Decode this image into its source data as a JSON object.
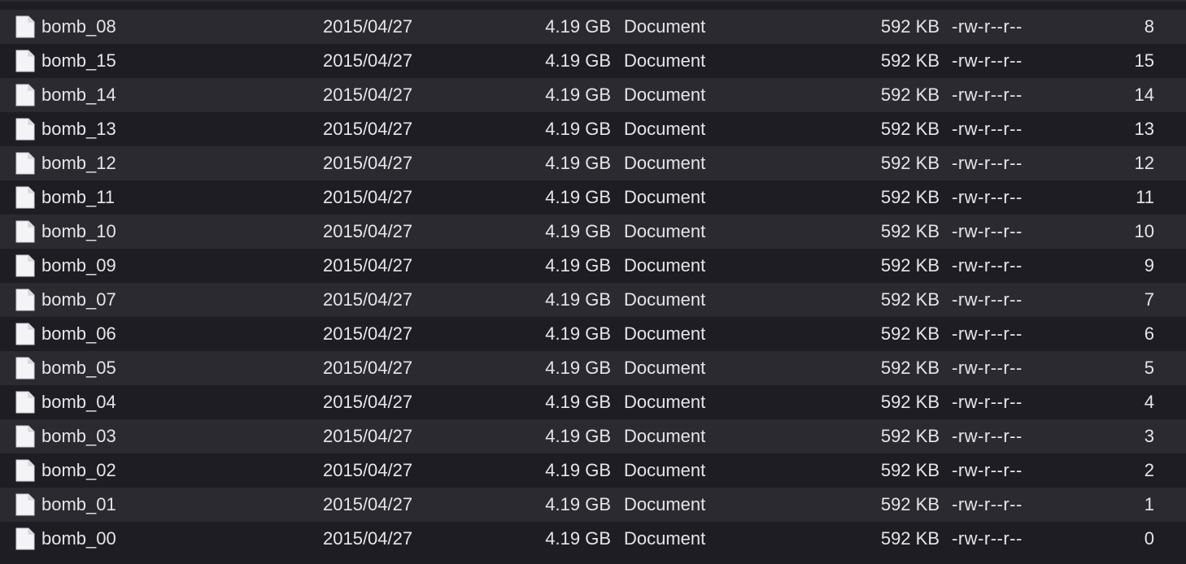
{
  "files": [
    {
      "name": "bomb_08",
      "date": "2015/04/27",
      "size": "4.19 GB",
      "kind": "Document",
      "size_on_disk": "592 KB",
      "permissions": "-rw-r--r--",
      "number": "8",
      "icon": "document-icon"
    },
    {
      "name": "bomb_15",
      "date": "2015/04/27",
      "size": "4.19 GB",
      "kind": "Document",
      "size_on_disk": "592 KB",
      "permissions": "-rw-r--r--",
      "number": "15",
      "icon": "document-icon"
    },
    {
      "name": "bomb_14",
      "date": "2015/04/27",
      "size": "4.19 GB",
      "kind": "Document",
      "size_on_disk": "592 KB",
      "permissions": "-rw-r--r--",
      "number": "14",
      "icon": "document-icon"
    },
    {
      "name": "bomb_13",
      "date": "2015/04/27",
      "size": "4.19 GB",
      "kind": "Document",
      "size_on_disk": "592 KB",
      "permissions": "-rw-r--r--",
      "number": "13",
      "icon": "document-icon"
    },
    {
      "name": "bomb_12",
      "date": "2015/04/27",
      "size": "4.19 GB",
      "kind": "Document",
      "size_on_disk": "592 KB",
      "permissions": "-rw-r--r--",
      "number": "12",
      "icon": "document-icon"
    },
    {
      "name": "bomb_11",
      "date": "2015/04/27",
      "size": "4.19 GB",
      "kind": "Document",
      "size_on_disk": "592 KB",
      "permissions": "-rw-r--r--",
      "number": "11",
      "icon": "document-icon"
    },
    {
      "name": "bomb_10",
      "date": "2015/04/27",
      "size": "4.19 GB",
      "kind": "Document",
      "size_on_disk": "592 KB",
      "permissions": "-rw-r--r--",
      "number": "10",
      "icon": "document-icon"
    },
    {
      "name": "bomb_09",
      "date": "2015/04/27",
      "size": "4.19 GB",
      "kind": "Document",
      "size_on_disk": "592 KB",
      "permissions": "-rw-r--r--",
      "number": "9",
      "icon": "document-icon"
    },
    {
      "name": "bomb_07",
      "date": "2015/04/27",
      "size": "4.19 GB",
      "kind": "Document",
      "size_on_disk": "592 KB",
      "permissions": "-rw-r--r--",
      "number": "7",
      "icon": "document-icon"
    },
    {
      "name": "bomb_06",
      "date": "2015/04/27",
      "size": "4.19 GB",
      "kind": "Document",
      "size_on_disk": "592 KB",
      "permissions": "-rw-r--r--",
      "number": "6",
      "icon": "document-icon"
    },
    {
      "name": "bomb_05",
      "date": "2015/04/27",
      "size": "4.19 GB",
      "kind": "Document",
      "size_on_disk": "592 KB",
      "permissions": "-rw-r--r--",
      "number": "5",
      "icon": "document-icon"
    },
    {
      "name": "bomb_04",
      "date": "2015/04/27",
      "size": "4.19 GB",
      "kind": "Document",
      "size_on_disk": "592 KB",
      "permissions": "-rw-r--r--",
      "number": "4",
      "icon": "document-icon"
    },
    {
      "name": "bomb_03",
      "date": "2015/04/27",
      "size": "4.19 GB",
      "kind": "Document",
      "size_on_disk": "592 KB",
      "permissions": "-rw-r--r--",
      "number": "3",
      "icon": "document-icon"
    },
    {
      "name": "bomb_02",
      "date": "2015/04/27",
      "size": "4.19 GB",
      "kind": "Document",
      "size_on_disk": "592 KB",
      "permissions": "-rw-r--r--",
      "number": "2",
      "icon": "document-icon"
    },
    {
      "name": "bomb_01",
      "date": "2015/04/27",
      "size": "4.19 GB",
      "kind": "Document",
      "size_on_disk": "592 KB",
      "permissions": "-rw-r--r--",
      "number": "1",
      "icon": "document-icon"
    },
    {
      "name": "bomb_00",
      "date": "2015/04/27",
      "size": "4.19 GB",
      "kind": "Document",
      "size_on_disk": "592 KB",
      "permissions": "-rw-r--r--",
      "number": "0",
      "icon": "document-icon"
    }
  ],
  "colors": {
    "background": "#1e1d23",
    "row_alt": "#2a2a30",
    "text": "#e6e6e8",
    "icon_fill": "#f4f4f6"
  }
}
